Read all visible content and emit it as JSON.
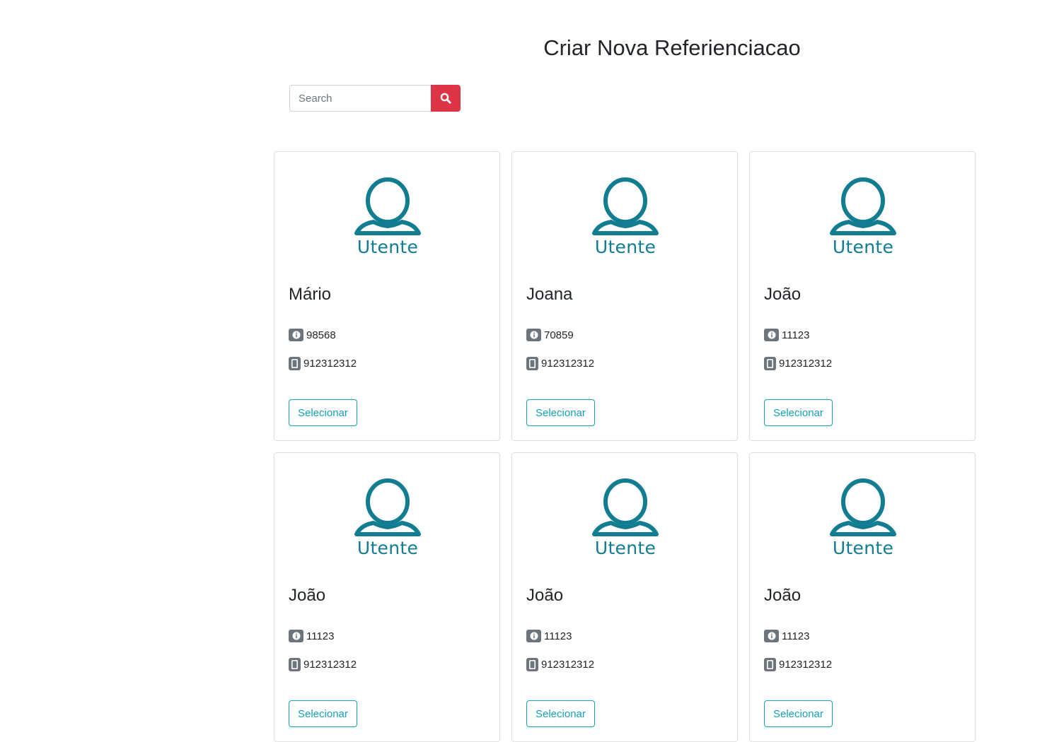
{
  "page": {
    "title": "Criar Nova Referienciacao"
  },
  "search": {
    "placeholder": "Search",
    "value": "",
    "button_icon": "search-icon",
    "button_color": "#dc3545"
  },
  "theme": {
    "accent": "#127d91",
    "button_outline": "#17a2b8",
    "icon_gray": "#6c757d"
  },
  "cards": [
    {
      "avatar_caption": "Utente",
      "name": "Mário",
      "id": "98568",
      "phone": "912312312",
      "button_label": "Selecionar"
    },
    {
      "avatar_caption": "Utente",
      "name": "Joana",
      "id": "70859",
      "phone": "912312312",
      "button_label": "Selecionar"
    },
    {
      "avatar_caption": "Utente",
      "name": "João",
      "id": "11123",
      "phone": "912312312",
      "button_label": "Selecionar"
    },
    {
      "avatar_caption": "Utente",
      "name": "João",
      "id": "11123",
      "phone": "912312312",
      "button_label": "Selecionar"
    },
    {
      "avatar_caption": "Utente",
      "name": "João",
      "id": "11123",
      "phone": "912312312",
      "button_label": "Selecionar"
    },
    {
      "avatar_caption": "Utente",
      "name": "João",
      "id": "11123",
      "phone": "912312312",
      "button_label": "Selecionar"
    }
  ]
}
